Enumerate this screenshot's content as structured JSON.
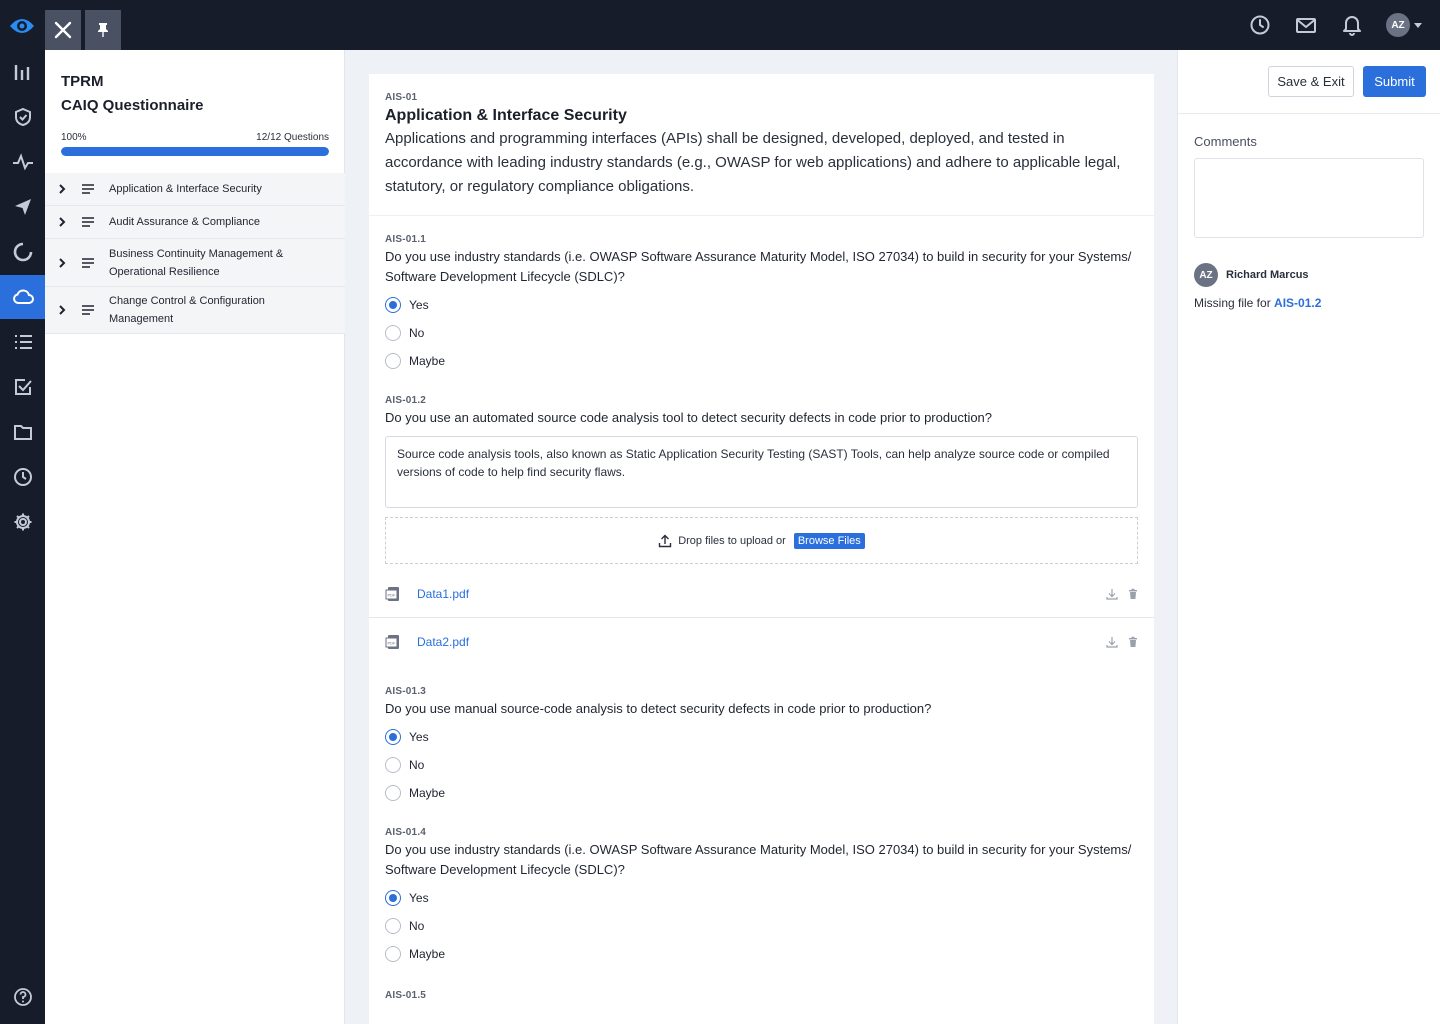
{
  "app": {
    "avatar_initials": "AZ",
    "accent_color": "#2a6fdb"
  },
  "topbar": {
    "icons": [
      "history-icon",
      "mail-icon",
      "bell-icon"
    ]
  },
  "rail": {
    "items": [
      "chart-icon",
      "shield-icon",
      "pulse-icon",
      "send-icon",
      "cycle-icon",
      "cloud-icon",
      "list-icon",
      "checkbox-icon",
      "folder-icon",
      "clock-icon",
      "gear-icon",
      "help-icon"
    ],
    "active": "cloud-icon"
  },
  "sidebar": {
    "title": "TPRM",
    "subtitle": "CAIQ Questionnaire",
    "progress_label": "100%",
    "progress_value": 1.0,
    "questions_label": "12/12 Questions",
    "items": [
      {
        "label": "Application & Interface Security"
      },
      {
        "label": "Audit Assurance & Compliance"
      },
      {
        "label": "Business Continuity Management & Operational Resilience"
      },
      {
        "label": "Change Control & Configuration Management"
      }
    ]
  },
  "section": {
    "code": "AIS-01",
    "title": "Application & Interface Security",
    "description": "Applications and programming interfaces (APIs) shall be designed, developed, deployed, and tested in accordance with leading industry standards (e.g., OWASP for web applications) and adhere to applicable legal, statutory, or regulatory compliance obligations."
  },
  "options": {
    "yes": "Yes",
    "no": "No",
    "maybe": "Maybe"
  },
  "questions": [
    {
      "code": "AIS-01.1",
      "text": "Do you use industry standards (i.e. OWASP Software Assurance Maturity Model, ISO 27034) to build in security for your Systems/ Software Development Lifecycle (SDLC)?",
      "selected": "Yes"
    },
    {
      "code": "AIS-01.2",
      "text": "Do you use an automated source code analysis tool to detect security defects in code prior to production?",
      "answer": "Source code analysis tools, also known as Static Application Security Testing (SAST) Tools, can help analyze source code or compiled versions of code to help find security flaws."
    },
    {
      "code": "AIS-01.3",
      "text": "Do you use manual source-code analysis to detect security defects in code prior to production?",
      "selected": "Yes"
    },
    {
      "code": "AIS-01.4",
      "text": "Do you use industry standards (i.e. OWASP Software Assurance Maturity Model, ISO 27034) to build in security for your Systems/ Software Development Lifecycle (SDLC)?",
      "selected": "Yes"
    },
    {
      "code": "AIS-01.5"
    }
  ],
  "upload": {
    "drop_text": "Drop files to upload or",
    "browse_label": "Browse Files"
  },
  "files": [
    {
      "name": "Data1.pdf"
    },
    {
      "name": "Data2.pdf"
    }
  ],
  "rpanel": {
    "save_label": "Save & Exit",
    "submit_label": "Submit",
    "comments_label": "Comments",
    "comment": {
      "author_initials": "AZ",
      "author": "Richard Marcus",
      "message": "Missing file for",
      "ref": "AIS-01.2"
    }
  }
}
